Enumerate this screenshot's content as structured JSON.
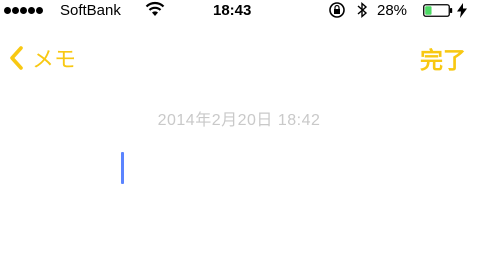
{
  "status_bar": {
    "carrier": "SoftBank",
    "time": "18:43",
    "battery_percent": "28%",
    "battery_level": 0.28,
    "signal_bars": 5
  },
  "nav": {
    "back_label": "メモ",
    "done_label": "完了"
  },
  "note": {
    "date": "2014年2月20日 18:42",
    "body": ""
  },
  "colors": {
    "accent": "#f8c812",
    "caret": "#5b84ff",
    "date_text": "#c9c9c9",
    "battery_fill": "#4cd964"
  },
  "icons": [
    "signal-icon",
    "wifi-icon",
    "rotation-lock-icon",
    "bluetooth-icon",
    "battery-icon",
    "charging-icon",
    "chevron-left-icon"
  ]
}
